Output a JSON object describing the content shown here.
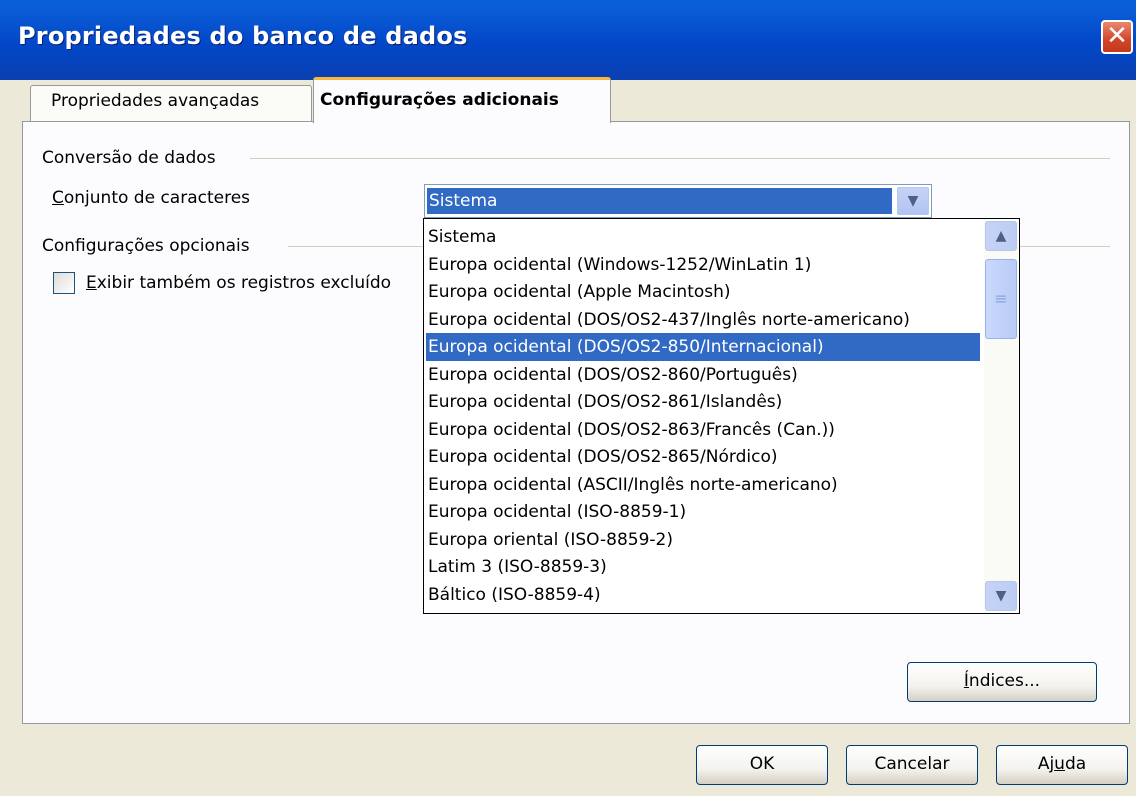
{
  "window": {
    "title": "Propriedades do banco de dados",
    "close_glyph": "✕"
  },
  "tabs": [
    {
      "label": "Propriedades avançadas",
      "active": false
    },
    {
      "label": "Configurações adicionais",
      "active": true
    }
  ],
  "conversion": {
    "section_label": "Conversão de dados",
    "charset_label_mnemonic": "C",
    "charset_label_rest": "onjunto de caracteres",
    "charset_value": "Sistema"
  },
  "optional": {
    "section_label": "Configurações opcionais",
    "checkbox_label_mnemonic": "E",
    "checkbox_label_rest": "xibir também os registros excluído",
    "checkbox_checked": false
  },
  "dropdown": {
    "selected_index": 4,
    "items": [
      "Sistema",
      "Europa ocidental (Windows-1252/WinLatin 1)",
      "Europa ocidental (Apple Macintosh)",
      "Europa ocidental (DOS/OS2-437/Inglês norte-americano)",
      "Europa ocidental (DOS/OS2-850/Internacional)",
      "Europa ocidental (DOS/OS2-860/Português)",
      "Europa ocidental (DOS/OS2-861/Islandês)",
      "Europa ocidental (DOS/OS2-863/Francês (Can.))",
      "Europa ocidental (DOS/OS2-865/Nórdico)",
      "Europa ocidental (ASCII/Inglês norte-americano)",
      "Europa ocidental (ISO-8859-1)",
      "Europa oriental (ISO-8859-2)",
      "Latim 3 (ISO-8859-3)",
      "Báltico (ISO-8859-4)"
    ]
  },
  "buttons": {
    "indices_mnemonic": "Í",
    "indices_rest": "ndices...",
    "ok": "OK",
    "cancel": "Cancelar",
    "help_pre": "Aj",
    "help_mnemonic": "u",
    "help_post": "da"
  },
  "icons": {
    "dropdown_arrow": "chevron-down-icon",
    "scroll_up": "chevron-up-icon",
    "scroll_down": "chevron-down-icon",
    "thumb_grip": "grip-icon"
  },
  "colors": {
    "title_bar": "#0247c8",
    "selection": "#316ac5",
    "active_tab_accent": "#f7b73c",
    "close_button": "#d2452a"
  }
}
